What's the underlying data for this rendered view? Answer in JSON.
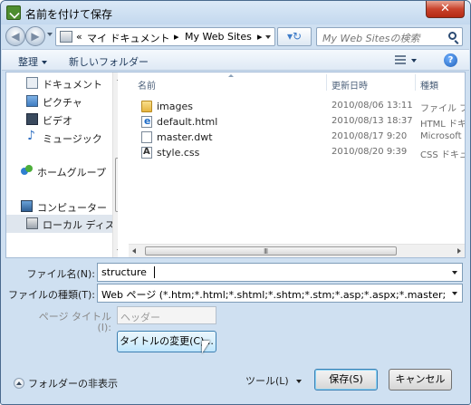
{
  "window": {
    "title": "名前を付けて保存",
    "close_label": "✕"
  },
  "address": {
    "segments": [
      "«",
      "マイ ドキュメント",
      "▸",
      "My Web Sites",
      "▸"
    ],
    "search_placeholder": "My Web Sitesの検索"
  },
  "toolbar": {
    "organize": "整理",
    "new_folder": "新しいフォルダー",
    "help": "?"
  },
  "nav": {
    "items": [
      {
        "label": "ドキュメント",
        "icon": "documents-icon"
      },
      {
        "label": "ピクチャ",
        "icon": "pictures-icon"
      },
      {
        "label": "ビデオ",
        "icon": "videos-icon"
      },
      {
        "label": "ミュージック",
        "icon": "music-icon"
      },
      {
        "label": "ホームグループ",
        "icon": "homegroup-icon"
      },
      {
        "label": "コンピューター",
        "icon": "computer-icon"
      },
      {
        "label": "ローカル ディス",
        "icon": "local-disk-icon"
      }
    ]
  },
  "files": {
    "columns": [
      "名前",
      "更新日時",
      "種類"
    ],
    "rows": [
      {
        "name": "images",
        "date": "2010/08/06 13:11",
        "type": "ファイル フ",
        "icon": "folder-icon"
      },
      {
        "name": "default.html",
        "date": "2010/08/13 18:37",
        "type": "HTML ドキ",
        "icon": "html-file-icon"
      },
      {
        "name": "master.dwt",
        "date": "2010/08/17 9:20",
        "type": "Microsoft S",
        "icon": "dwt-file-icon"
      },
      {
        "name": "style.css",
        "date": "2010/08/20 9:39",
        "type": "CSS ドキュ",
        "icon": "css-file-icon"
      }
    ],
    "scroll_grip": "III"
  },
  "form": {
    "filename_label": "ファイル名(N):",
    "filename_value": "structure",
    "filetype_label": "ファイルの種類(T):",
    "filetype_value": "Web ページ (*.htm;*.html;*.shtml;*.shtm;*.stm;*.asp;*.aspx;*.master;*.dwt;*",
    "page_title_label_1": "ページ タイトル",
    "page_title_label_2": "(I):",
    "page_title_placeholder": "ヘッダー",
    "change_title_button": "タイトルの変更(C)..."
  },
  "footer": {
    "hide_folders": "フォルダーの非表示",
    "tools": "ツール(L)",
    "save": "保存(S)",
    "cancel": "キャンセル"
  }
}
